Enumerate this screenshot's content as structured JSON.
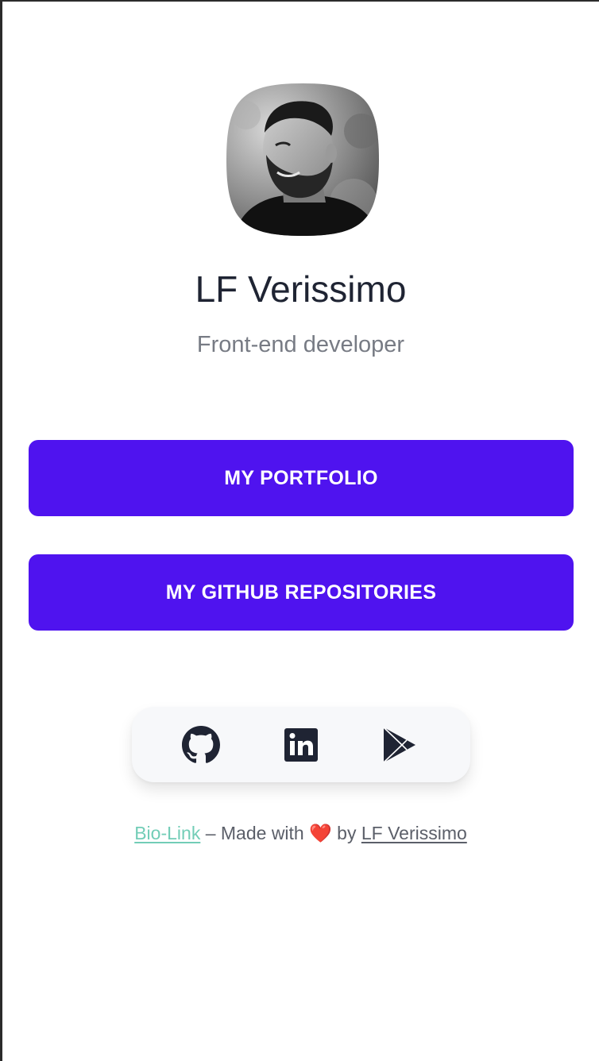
{
  "profile": {
    "name": "LF Verissimo",
    "tagline": "Front-end developer"
  },
  "links": [
    {
      "label": "MY PORTFOLIO"
    },
    {
      "label": "MY GITHUB REPOSITORIES"
    }
  ],
  "social": [
    {
      "icon": "github-icon"
    },
    {
      "icon": "linkedin-icon"
    },
    {
      "icon": "google-play-icon"
    }
  ],
  "footer": {
    "brand_link": "Bio-Link",
    "made_with": "– Made with",
    "heart": "❤️",
    "by": "by",
    "author_link": "LF Verissimo"
  },
  "colors": {
    "button_bg": "#4f13ef",
    "button_text": "#ffffff",
    "name_text": "#1f2433",
    "tagline_text": "#777b84",
    "brand_link": "#72cdb7",
    "social_bg": "#f7f8fa",
    "icon_color": "#1f2433"
  }
}
